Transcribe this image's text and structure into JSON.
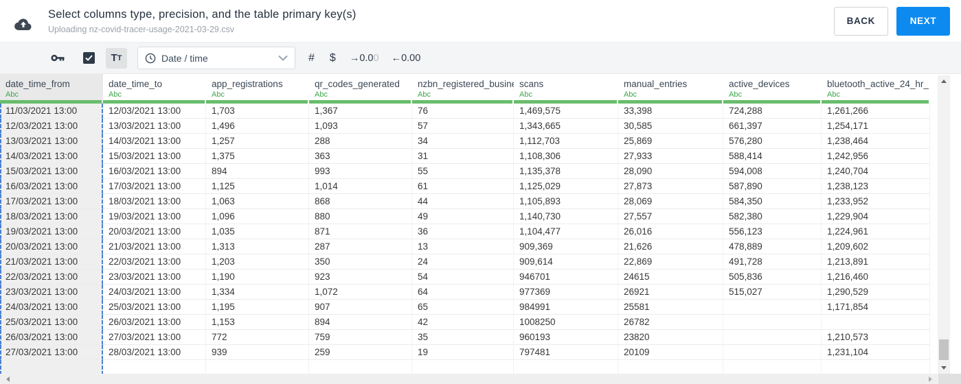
{
  "header": {
    "title": "Select columns type, precision, and the table primary key(s)",
    "subtitle": "Uploading nz-covid-tracer-usage-2021-03-29.csv",
    "back_label": "BACK",
    "next_label": "NEXT"
  },
  "toolbar": {
    "primary_key_checkbox_checked": true,
    "text_type_main": "T",
    "text_type_sub": "T",
    "type_value": "Date / time",
    "numeric_label": "#",
    "currency_label": "$",
    "decrease": {
      "arrow": "→",
      "main": "0.0",
      "muted": "0"
    },
    "increase": {
      "arrow": "←",
      "main": "0.00"
    }
  },
  "colors": {
    "accent_blue": "#0d8af0",
    "header_bar_green": "#69bd6c",
    "type_label_green": "#3da44a",
    "selection_dash_blue": "#4b80d4"
  },
  "table": {
    "columns": [
      {
        "name": "date_time_from",
        "type_label": "Abc",
        "selected": true
      },
      {
        "name": "date_time_to",
        "type_label": "Abc",
        "selected": false
      },
      {
        "name": "app_registrations",
        "type_label": "Abc",
        "selected": false
      },
      {
        "name": "qr_codes_generated",
        "type_label": "Abc",
        "selected": false
      },
      {
        "name": "nzbn_registered_busine",
        "type_label": "Abc",
        "selected": false
      },
      {
        "name": "scans",
        "type_label": "Abc",
        "selected": false
      },
      {
        "name": "manual_entries",
        "type_label": "Abc",
        "selected": false
      },
      {
        "name": "active_devices",
        "type_label": "Abc",
        "selected": false
      },
      {
        "name": "bluetooth_active_24_hr_",
        "type_label": "Abc",
        "selected": false
      }
    ],
    "rows": [
      [
        "11/03/2021 13:00",
        "12/03/2021 13:00",
        "1,703",
        "1,367",
        "76",
        "1,469,575",
        "33,398",
        "724,288",
        "1,261,266"
      ],
      [
        "12/03/2021 13:00",
        "13/03/2021 13:00",
        "1,496",
        "1,093",
        "57",
        "1,343,665",
        "30,585",
        "661,397",
        "1,254,171"
      ],
      [
        "13/03/2021 13:00",
        "14/03/2021 13:00",
        "1,257",
        "288",
        "34",
        "1,112,703",
        "25,869",
        "576,280",
        "1,238,464"
      ],
      [
        "14/03/2021 13:00",
        "15/03/2021 13:00",
        "1,375",
        "363",
        "31",
        "1,108,306",
        "27,933",
        "588,414",
        "1,242,956"
      ],
      [
        "15/03/2021 13:00",
        "16/03/2021 13:00",
        "894",
        "993",
        "55",
        "1,135,378",
        "28,090",
        "594,008",
        "1,240,704"
      ],
      [
        "16/03/2021 13:00",
        "17/03/2021 13:00",
        "1,125",
        "1,014",
        "61",
        "1,125,029",
        "27,873",
        "587,890",
        "1,238,123"
      ],
      [
        "17/03/2021 13:00",
        "18/03/2021 13:00",
        "1,063",
        "868",
        "44",
        "1,105,893",
        "28,069",
        "584,350",
        "1,233,952"
      ],
      [
        "18/03/2021 13:00",
        "19/03/2021 13:00",
        "1,096",
        "880",
        "49",
        "1,140,730",
        "27,557",
        "582,380",
        "1,229,904"
      ],
      [
        "19/03/2021 13:00",
        "20/03/2021 13:00",
        "1,035",
        "871",
        "36",
        "1,104,477",
        "26,016",
        "556,123",
        "1,224,961"
      ],
      [
        "20/03/2021 13:00",
        "21/03/2021 13:00",
        "1,313",
        "287",
        "13",
        "909,369",
        "21,626",
        "478,889",
        "1,209,602"
      ],
      [
        "21/03/2021 13:00",
        "22/03/2021 13:00",
        "1,203",
        "350",
        "24",
        "909,614",
        "22,869",
        "491,728",
        "1,213,891"
      ],
      [
        "22/03/2021 13:00",
        "23/03/2021 13:00",
        "1,190",
        "923",
        "54",
        "946701",
        "24615",
        "505,836",
        "1,216,460"
      ],
      [
        "23/03/2021 13:00",
        "24/03/2021 13:00",
        "1,334",
        "1,072",
        "64",
        "977369",
        "26921",
        "515,027",
        "1,290,529"
      ],
      [
        "24/03/2021 13:00",
        "25/03/2021 13:00",
        "1,195",
        "907",
        "65",
        "984991",
        "25581",
        "",
        "1,171,854"
      ],
      [
        "25/03/2021 13:00",
        "26/03/2021 13:00",
        "1,153",
        "894",
        "42",
        "1008250",
        "26782",
        "",
        ""
      ],
      [
        "26/03/2021 13:00",
        "27/03/2021 13:00",
        "772",
        "759",
        "35",
        "960193",
        "23820",
        "",
        "1,210,573"
      ],
      [
        "27/03/2021 13:00",
        "28/03/2021 13:00",
        "939",
        "259",
        "19",
        "797481",
        "20109",
        "",
        "1,231,104"
      ]
    ]
  }
}
